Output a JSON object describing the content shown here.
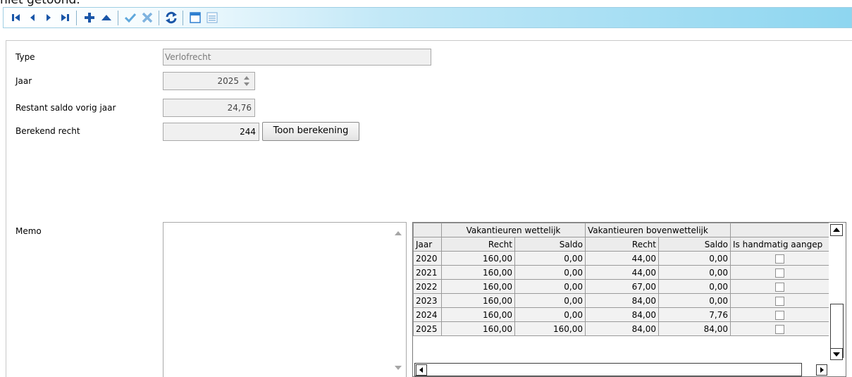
{
  "window_text": "niet getoond.",
  "toolbar": {
    "buttons": [
      "first-icon",
      "previous-icon",
      "next-icon",
      "last-icon",
      "add-icon",
      "move-up-icon",
      "confirm-icon",
      "cancel-icon",
      "refresh-icon",
      "window-icon",
      "list-view-icon"
    ]
  },
  "form": {
    "type_label": "Type",
    "type_value": "Verlofrecht",
    "jaar_label": "Jaar",
    "jaar_value": "2025",
    "restant_label": "Restant saldo vorig jaar",
    "restant_value": "24,76",
    "berekend_label": "Berekend recht",
    "berekend_value": "244",
    "toon_button": "Toon berekening",
    "memo_label": "Memo",
    "memo_value": ""
  },
  "grid": {
    "group_headers": [
      "",
      "Vakantieuren wettelijk",
      "Vakantieuren bovenwettelijk",
      ""
    ],
    "columns": [
      "Jaar",
      "Recht",
      "Saldo",
      "Recht",
      "Saldo",
      "Is handmatig aangep"
    ],
    "rows": [
      {
        "jaar": "2020",
        "w_recht": "160,00",
        "w_saldo": "0,00",
        "b_recht": "44,00",
        "b_saldo": "0,00",
        "handmatig": false
      },
      {
        "jaar": "2021",
        "w_recht": "160,00",
        "w_saldo": "0,00",
        "b_recht": "44,00",
        "b_saldo": "0,00",
        "handmatig": false
      },
      {
        "jaar": "2022",
        "w_recht": "160,00",
        "w_saldo": "0,00",
        "b_recht": "67,00",
        "b_saldo": "0,00",
        "handmatig": false
      },
      {
        "jaar": "2023",
        "w_recht": "160,00",
        "w_saldo": "0,00",
        "b_recht": "84,00",
        "b_saldo": "0,00",
        "handmatig": false
      },
      {
        "jaar": "2024",
        "w_recht": "160,00",
        "w_saldo": "0,00",
        "b_recht": "84,00",
        "b_saldo": "7,76",
        "handmatig": false
      },
      {
        "jaar": "2025",
        "w_recht": "160,00",
        "w_saldo": "160,00",
        "b_recht": "84,00",
        "b_saldo": "84,00",
        "handmatig": false
      }
    ]
  },
  "colors": {
    "toolbar_accent": "#8ed6f0",
    "icon_blue": "#1a56a8",
    "icon_check": "#5fa8dc",
    "icon_x": "#7fb3df"
  }
}
